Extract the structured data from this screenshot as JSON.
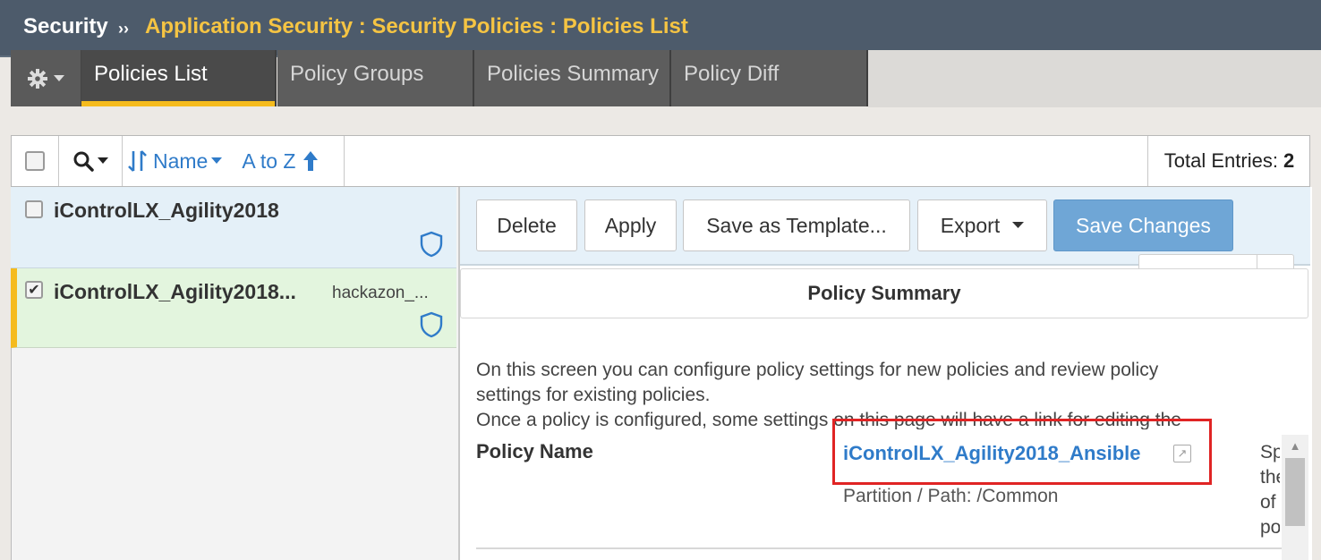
{
  "breadcrumb": {
    "root": "Security",
    "separator": "››",
    "path": "Application Security : Security Policies : Policies List"
  },
  "tabs": [
    {
      "label": "Policies List",
      "active": true
    },
    {
      "label": "Policy Groups",
      "active": false
    },
    {
      "label": "Policies Summary",
      "active": false
    },
    {
      "label": "Policy Diff",
      "active": false
    }
  ],
  "toolbar": {
    "sort_field": "Name",
    "sort_order": "A to Z",
    "total_label": "Total Entries:",
    "total_value": "2"
  },
  "policies": [
    {
      "name": "iControlLX_Agility2018",
      "subtext": "",
      "checked": false
    },
    {
      "name": "iControlLX_Agility2018...",
      "subtext": "hackazon_...",
      "checked": true
    }
  ],
  "actions": {
    "delete": "Delete",
    "apply": "Apply",
    "save_template": "Save as Template...",
    "export": "Export",
    "save_changes": "Save Changes"
  },
  "summary": {
    "header": "Policy Summary",
    "description_lines": [
      "On this screen you can configure policy settings for new policies and review policy",
      "settings for existing policies.",
      "Once a policy is configured, some settings on this page will have a link for editing the"
    ],
    "policy_name_label": "Policy Name",
    "policy_name_value": "iControlLX_Agility2018_Ansible",
    "partition_path": "Partition / Path: /Common",
    "side_fragments": [
      "Sp",
      "the",
      "of",
      "po"
    ]
  },
  "colors": {
    "breadcrumb_bg": "#4d5b6b",
    "breadcrumb_path": "#f5c443",
    "tab_active_underline": "#f5bb1d",
    "link_blue": "#2f7bc9",
    "primary_button": "#6fa6d6",
    "highlight_box": "#e02424"
  }
}
